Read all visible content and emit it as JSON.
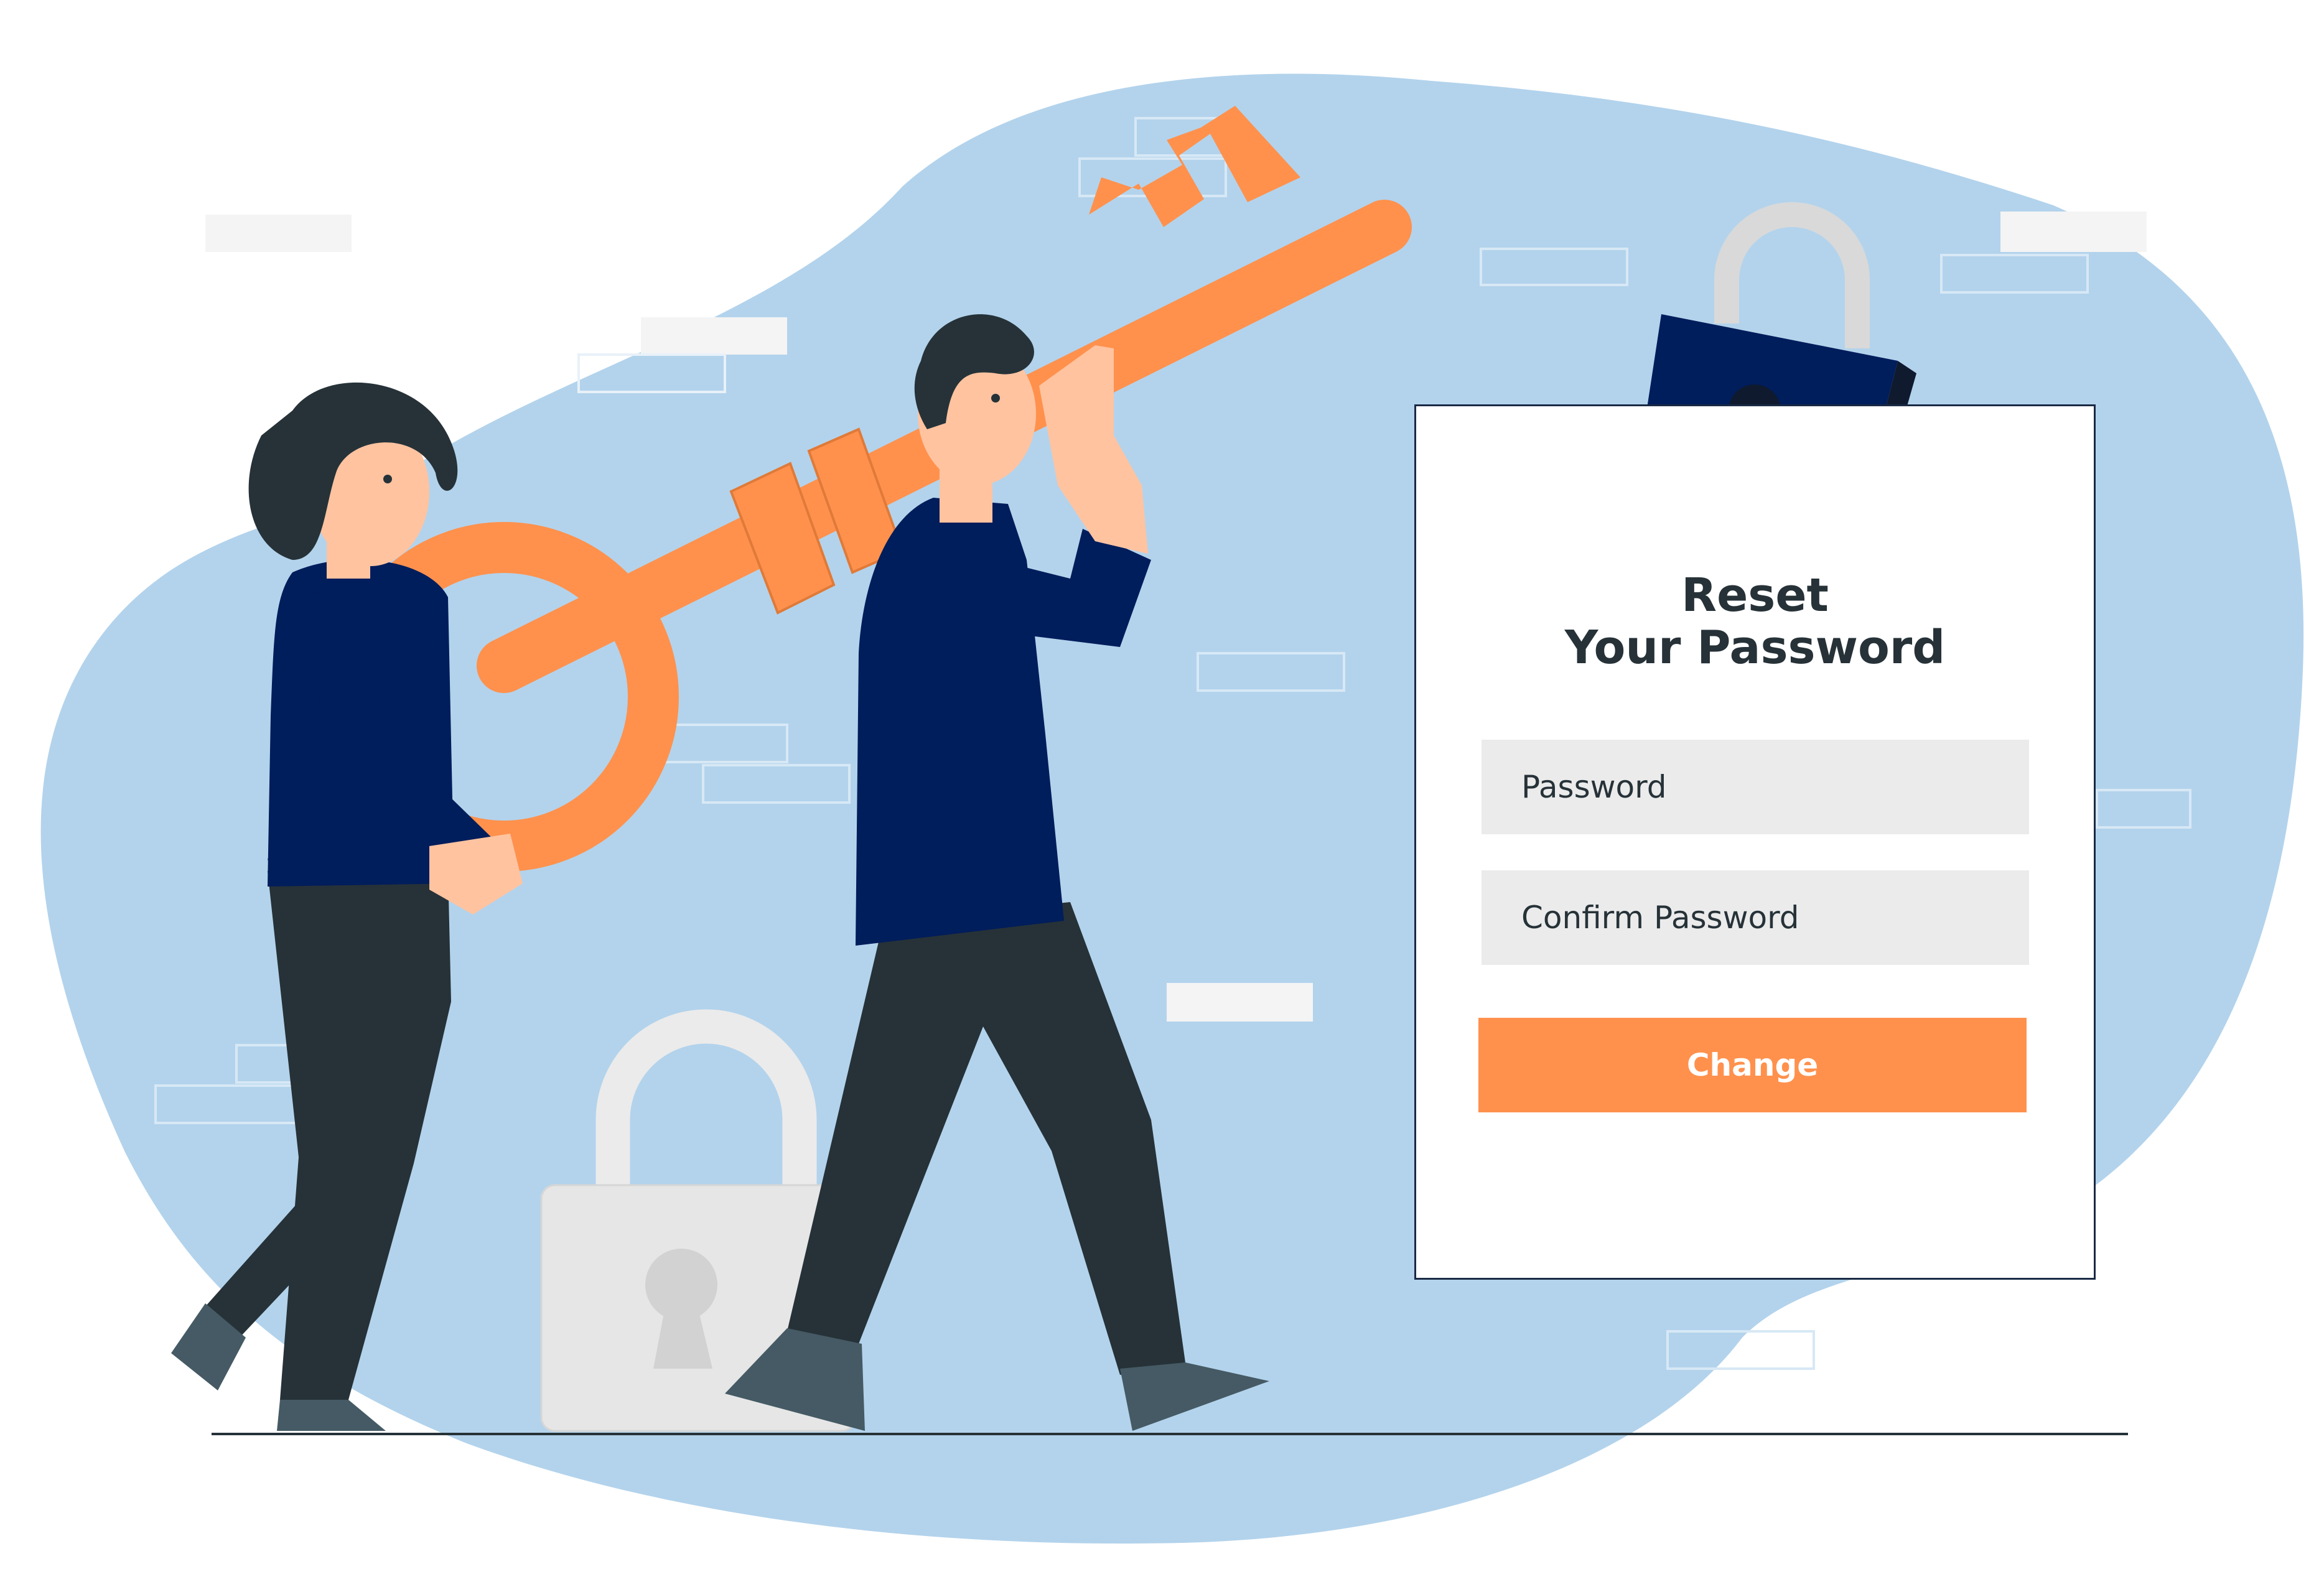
{
  "form": {
    "title_line1": "Reset",
    "title_line2": "Your Password",
    "password_placeholder": "Password",
    "confirm_placeholder": "Confirm Password",
    "submit_label": "Change"
  },
  "colors": {
    "blob": "#b3d3ec",
    "navy": "#001d5c",
    "dark": "#263238",
    "accent": "#ff914d",
    "field_bg": "#ebebeb",
    "skin": "#ffc3a0"
  },
  "icons": [
    "key-icon",
    "padlock-icon",
    "keyhole-icon"
  ]
}
